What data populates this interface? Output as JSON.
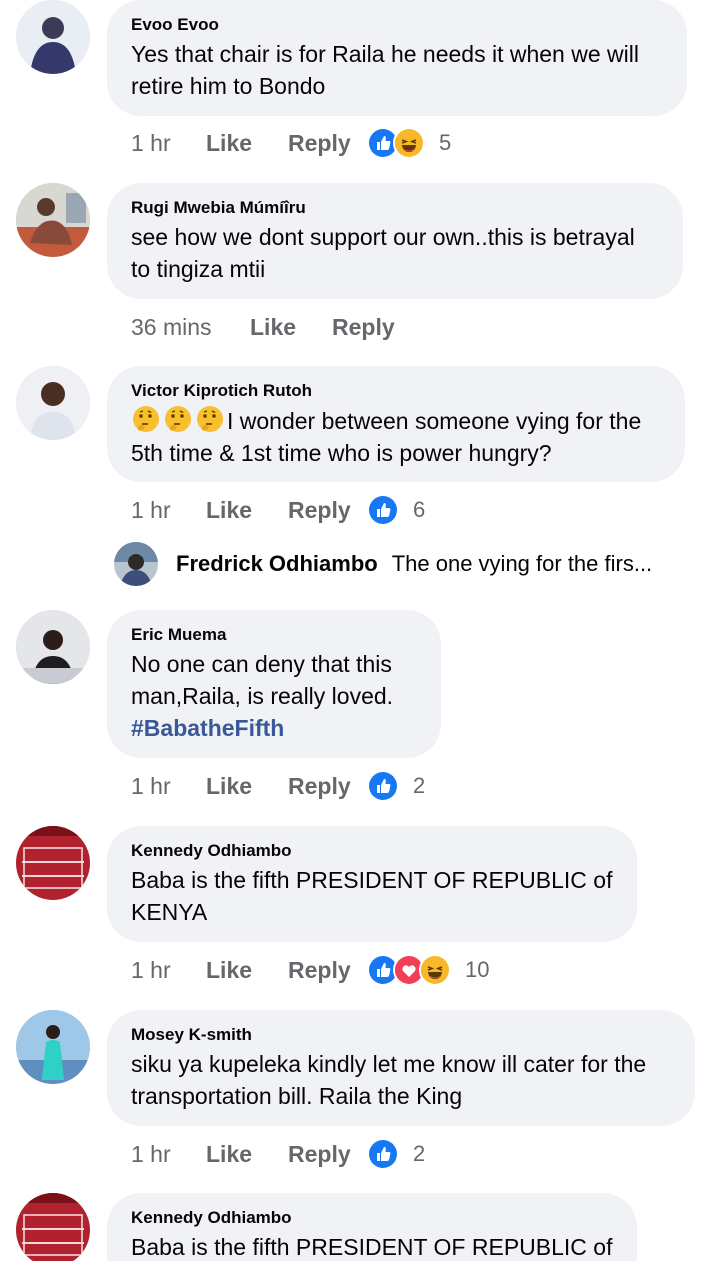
{
  "comments": [
    {
      "author": "Evoo Evoo",
      "text": "Yes that chair is for Raila he needs it when we will retire him to Bondo",
      "time": "1 hr",
      "like": "Like",
      "reply": "Reply",
      "reactions": [
        "like",
        "haha"
      ],
      "reaction_count": "5"
    },
    {
      "author": "Rugi Mwebia Múmíîru",
      "text": "see how we dont support our own..this is betrayal to tingiza mtii",
      "time": "36 mins",
      "like": "Like",
      "reply": "Reply",
      "reactions": [],
      "reaction_count": ""
    },
    {
      "author": "Victor Kiprotich Rutoh",
      "text": "I wonder between someone vying for the 5th time & 1st time who is power hungry?",
      "emoji_prefix": [
        "thinking-face",
        "thinking-face",
        "thinking-face"
      ],
      "time": "1 hr",
      "like": "Like",
      "reply": "Reply",
      "reactions": [
        "like"
      ],
      "reaction_count": "6"
    },
    {
      "author": "Eric Muema",
      "text": "No one can deny that this man,Raila, is really loved.",
      "hashtag": "#BabatheFifth",
      "time": "1 hr",
      "like": "Like",
      "reply": "Reply",
      "reactions": [
        "like"
      ],
      "reaction_count": "2"
    },
    {
      "author": "Kennedy Odhiambo",
      "text": "Baba is the fifth PRESIDENT OF REPUBLIC of KENYA",
      "time": "1 hr",
      "like": "Like",
      "reply": "Reply",
      "reactions": [
        "like",
        "love",
        "haha"
      ],
      "reaction_count": "10"
    },
    {
      "author": "Mosey K-smith",
      "text": "siku ya kupeleka kindly let me know ill cater for the transportation bill. Raila the King",
      "time": "1 hr",
      "like": "Like",
      "reply": "Reply",
      "reactions": [
        "like"
      ],
      "reaction_count": "2"
    },
    {
      "author": "Kennedy Odhiambo",
      "text": "Baba is the fifth PRESIDENT OF REPUBLIC of"
    }
  ],
  "reply_preview": {
    "author": "Fredrick Odhiambo",
    "text": "The one vying for the firs..."
  },
  "colors": {
    "bubble": "#f0f2f5",
    "meta": "#65676b",
    "like_blue": "#1877f2",
    "love_red": "#f33e58",
    "haha_yellow": "#f7b928",
    "hashtag": "#385898"
  }
}
